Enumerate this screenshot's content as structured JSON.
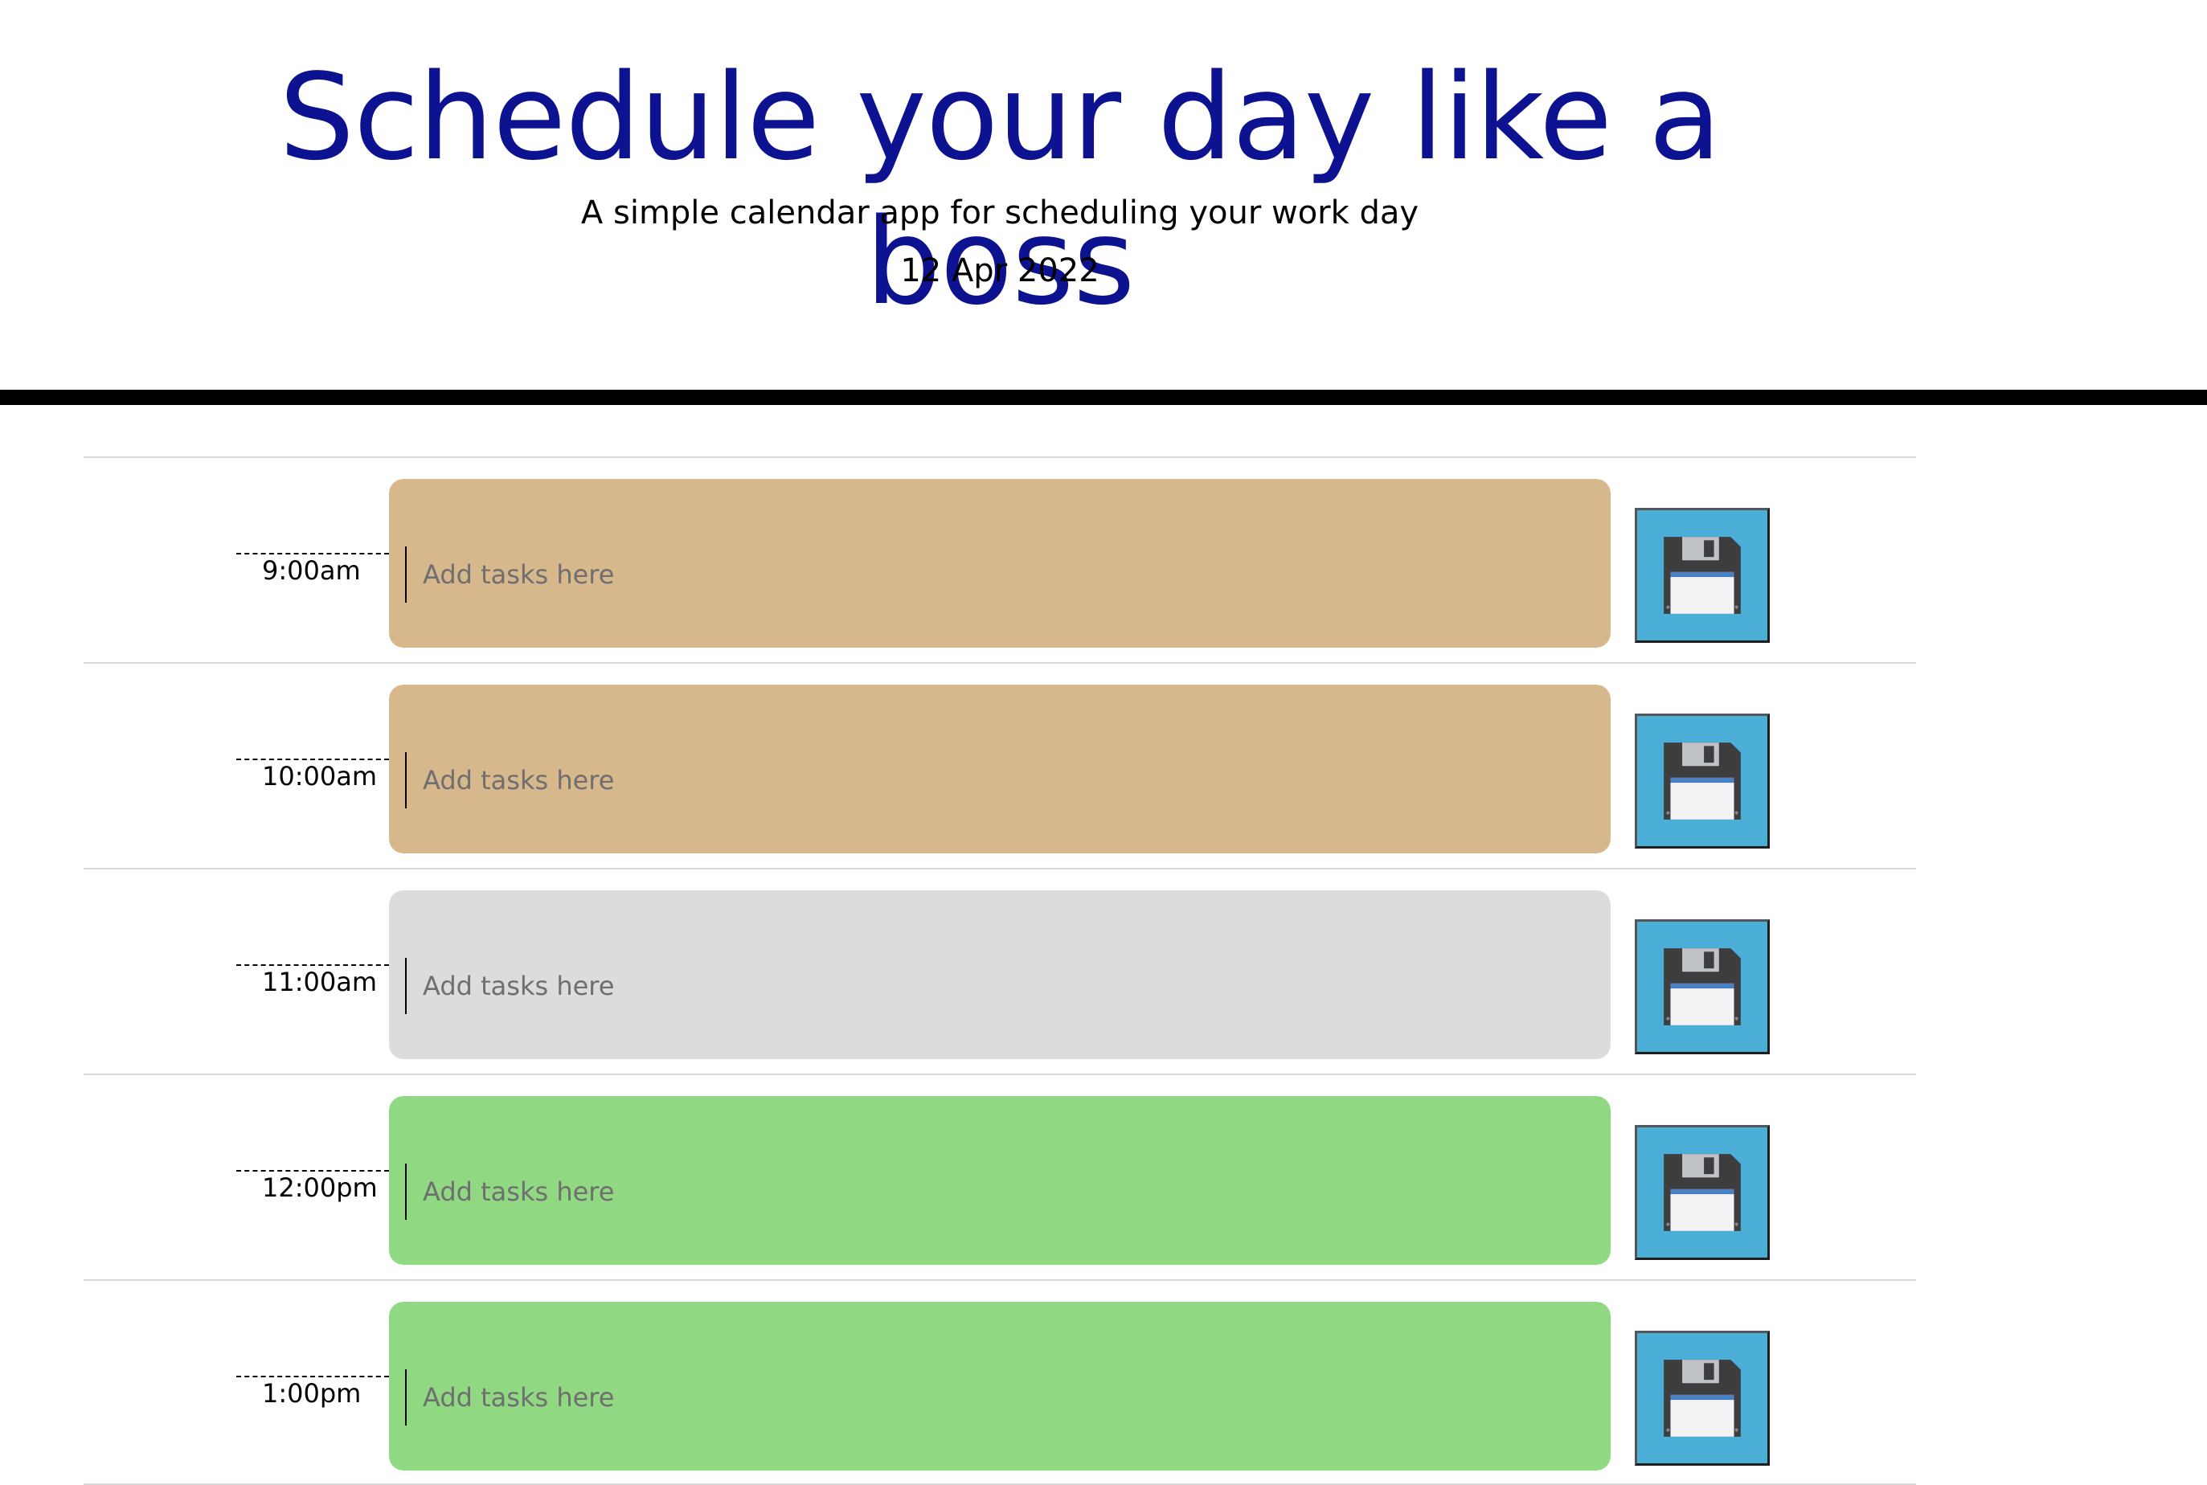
{
  "header": {
    "title": "Schedule your day like a boss",
    "subtitle": "A simple calendar app for scheduling your work day",
    "date": "12 Apr 2022"
  },
  "colors": {
    "title": "#0d1290",
    "past": "#d7b88c",
    "present": "#dcdcdc",
    "future": "#90d982",
    "save_button": "#4baed6"
  },
  "timeblocks": [
    {
      "hour": "9:00am",
      "placeholder": "Add tasks here",
      "status": "past",
      "save_icon": "floppy-disk-icon"
    },
    {
      "hour": "10:00am",
      "placeholder": "Add tasks here",
      "status": "past",
      "save_icon": "floppy-disk-icon"
    },
    {
      "hour": "11:00am",
      "placeholder": "Add tasks here",
      "status": "present",
      "save_icon": "floppy-disk-icon"
    },
    {
      "hour": "12:00pm",
      "placeholder": "Add tasks here",
      "status": "future",
      "save_icon": "floppy-disk-icon"
    },
    {
      "hour": "1:00pm",
      "placeholder": "Add tasks here",
      "status": "future",
      "save_icon": "floppy-disk-icon"
    }
  ]
}
